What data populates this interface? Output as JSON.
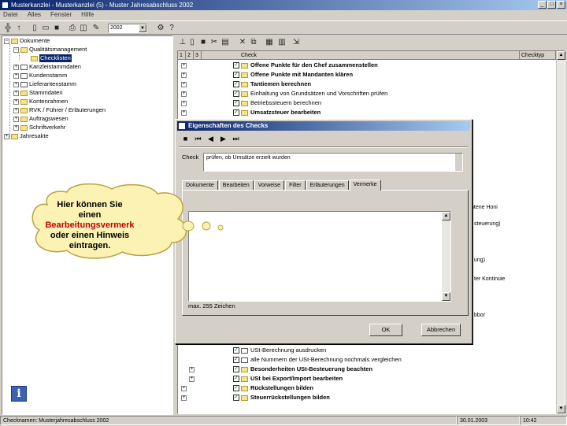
{
  "window": {
    "title": "Musterkanzlei - Musterkanzlei (5) - Muster Jahresabschluss 2002",
    "controls": [
      "_",
      "□",
      "×"
    ]
  },
  "menu": [
    "Datei",
    "Alles",
    "Fenster",
    "Hilfe"
  ],
  "toolbar": {
    "year": "2002"
  },
  "tree": {
    "items": [
      {
        "label": "Dokumente"
      },
      {
        "label": "Qualitätsmanagement"
      },
      {
        "label": "Checklisten"
      },
      {
        "label": "Kanzleistammdaten"
      },
      {
        "label": "Kundenstamm"
      },
      {
        "label": "Lieferantenstamm"
      },
      {
        "label": "Stammdaten"
      },
      {
        "label": "Kontenrahmen"
      },
      {
        "label": "RVK / Führer / Erläuterungen"
      },
      {
        "label": "Auftragswesen"
      },
      {
        "label": "Schriftverkehr"
      },
      {
        "label": "Jahresakte"
      }
    ]
  },
  "grid": {
    "headers": [
      "1",
      "2",
      "3",
      "Check",
      "Checktyp"
    ],
    "rows_top": [
      {
        "text": "Offene Punkte für den Chef zusammenstellen",
        "bold": true
      },
      {
        "text": "Offene Punkte mit Mandanten klären",
        "bold": true
      },
      {
        "text": "Tantiemen berechnen",
        "bold": true
      },
      {
        "text": "Einhaltung von Grundsätzen und Vorschriften prüfen",
        "bold": false
      },
      {
        "text": "Betriebssteuern berechnen",
        "bold": false
      },
      {
        "text": "Umsatzsteuer bearbeiten",
        "bold": true
      }
    ],
    "rows_bottom": [
      {
        "text": "USt-Berechnung ausdrucken",
        "bold": false
      },
      {
        "text": "alle Nummern der USt-Berechnung nochmals vergleichen",
        "bold": false
      },
      {
        "text": "Besonderheiten USt-Besteuerung beachten",
        "bold": true
      },
      {
        "text": "USt bei Export/Import bearbeiten",
        "bold": true
      },
      {
        "text": "Rückstellungen bilden",
        "bold": true
      },
      {
        "text": "Steuerrückstellungen bilden",
        "bold": true
      }
    ],
    "peek_texts": [
      "ntene Honi",
      "steuerung)",
      "ung)",
      "ter Kontinuie",
      "bbor"
    ]
  },
  "dialog": {
    "title": "Eigenschaften des Checks",
    "check_label": "Check",
    "check_value": "prüfen, ob Umsätze erzielt wurden",
    "tabs": [
      "Dokumente",
      "Bearbeiten",
      "Vorweise",
      "Filter",
      "Erläuterungen",
      "Vermerke"
    ],
    "active_tab": "Vermerke",
    "max_chars": "max. 255 Zeichen",
    "ok": "OK",
    "cancel": "Abbrechen"
  },
  "callout": {
    "line1": "Hier können Sie",
    "line2": "einen",
    "line3": "Bearbeitungsvermerk",
    "line4": "oder einen Hinweis",
    "line5": "eintragen."
  },
  "statusbar": {
    "left": "Checknamen: Musterjahresabschluss 2002",
    "date": "30.01.2003",
    "time": "10:42"
  }
}
